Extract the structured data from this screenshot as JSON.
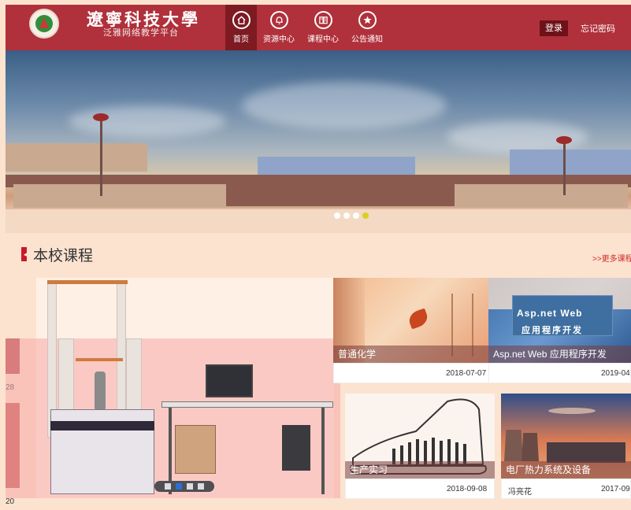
{
  "header": {
    "university_name": "遼寧科技大學",
    "platform_name": "泛雅网络教学平台",
    "nav": [
      {
        "label": "首页",
        "icon": "home-icon"
      },
      {
        "label": "资源中心",
        "icon": "bell-icon"
      },
      {
        "label": "课程中心",
        "icon": "book-icon"
      },
      {
        "label": "公告通知",
        "icon": "star-icon"
      }
    ],
    "login_label": "登录",
    "forgot_label": "忘记密码"
  },
  "banner": {
    "slides": 4,
    "active_slide": 4
  },
  "section": {
    "title": "本校课程",
    "more_label": ">>更多课程",
    "edge_dates": [
      "28",
      "20"
    ]
  },
  "feature_slider": {
    "slides": 4,
    "active_slide": 2
  },
  "courses": [
    {
      "title": "普通化学",
      "date": "2018-07-07",
      "author": ""
    },
    {
      "title": "Asp.net Web 应用程序开发",
      "date": "2019-04",
      "author": "",
      "cover_text_line1": "Asp.net Web",
      "cover_text_line2": "应用程序开发"
    },
    {
      "title": "生产实习",
      "date": "2018-09-08",
      "author": ""
    },
    {
      "title": "电厂热力系统及设备",
      "date": "2017-09",
      "author": "冯亮花"
    }
  ],
  "colors": {
    "header_bg": "#b0313b",
    "nav_active_bg": "#7e1a22",
    "login_bg": "#6e1219",
    "accent_red": "#c8182e",
    "page_bg": "#fbe3cf"
  }
}
